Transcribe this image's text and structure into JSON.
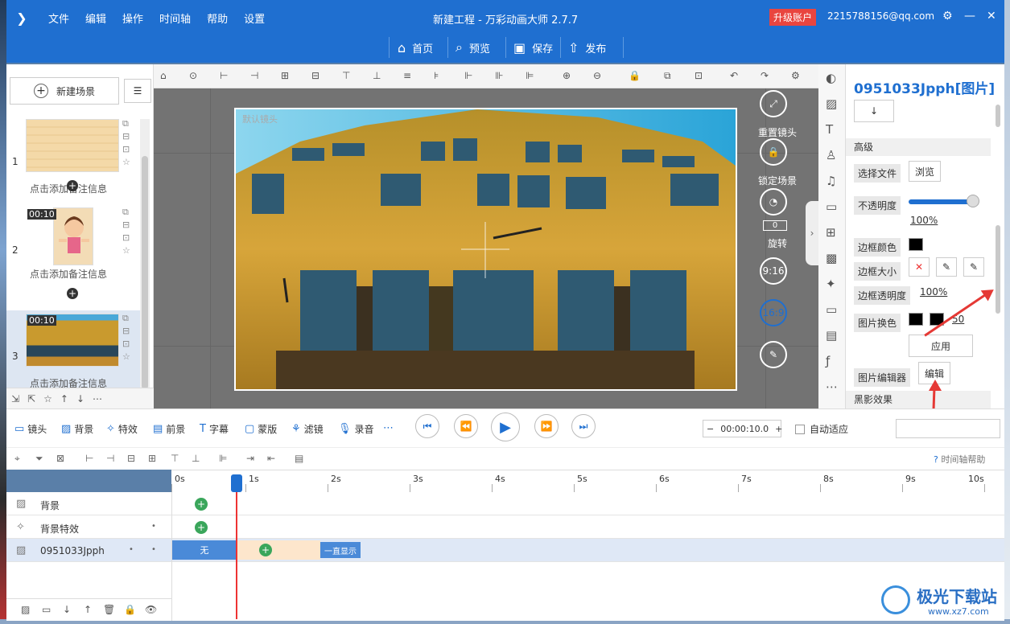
{
  "app": {
    "title": "新建工程 - 万彩动画大师 2.7.7",
    "menus": [
      "文件",
      "编辑",
      "操作",
      "时间轴",
      "帮助",
      "设置"
    ],
    "upgrade": "升级账户",
    "account": "2215788156@qq.com",
    "logo": "logo-icon"
  },
  "topbar": {
    "home": "首页",
    "preview": "预览",
    "save": "保存",
    "publish": "发布"
  },
  "scenes": {
    "new_scene": "新建场景",
    "items": [
      {
        "num": "1",
        "caption": "点击添加备注信息",
        "duration": ""
      },
      {
        "num": "2",
        "caption": "点击添加备注信息",
        "duration": "00:10"
      },
      {
        "num": "3",
        "caption": "点击添加备注信息",
        "duration": "00:10"
      }
    ]
  },
  "canvas": {
    "camera_label": "默认镜头",
    "tools": {
      "reset_camera": "重置镜头",
      "lock_scene": "锁定场景",
      "rotate": "旋转",
      "rotate_value": "0",
      "ratio_916": "9:16",
      "ratio_169": "16:9"
    }
  },
  "props": {
    "title": "0951033Jpph[图片]",
    "section_advanced": "高级",
    "select_file": "选择文件",
    "browse": "浏览",
    "opacity": "不透明度",
    "opacity_value": "100%",
    "opacity_level": 1.0,
    "border_color": "边框颜色",
    "border_size": "边框大小",
    "border_opacity": "边框透明度",
    "border_opacity_value": "100%",
    "image_recolor": "图片换色",
    "recolor_value": "50",
    "apply": "应用",
    "image_editor": "图片编辑器",
    "edit": "编辑",
    "section_bw": "黑影效果"
  },
  "timeline": {
    "tabs": [
      "镜头",
      "背景",
      "特效",
      "前景",
      "字幕",
      "蒙版",
      "滤镜",
      "录音"
    ],
    "time": "00:00:10.0",
    "auto_fit": "自动适应",
    "help": "时间轴帮助",
    "ticks": [
      "0s",
      "1s",
      "2s",
      "3s",
      "4s",
      "5s",
      "6s",
      "7s",
      "8s",
      "9s",
      "10s"
    ],
    "tracks": [
      {
        "name": "背景"
      },
      {
        "name": "背景特效"
      },
      {
        "name": "0951033Jpph"
      }
    ],
    "clip_enter": "无",
    "clip_exit": "一直显示"
  },
  "watermark": {
    "site": "极光下载站",
    "url": "www.xz7.com"
  },
  "colors": {
    "brand": "#1f6fd0",
    "upgrade": "#e9453f",
    "keyframe": "#3aa65b",
    "arrow": "#e53935"
  }
}
